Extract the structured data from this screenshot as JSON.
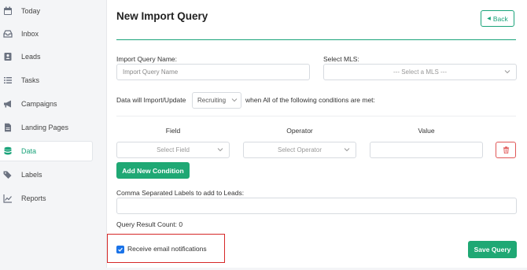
{
  "sidebar": {
    "items": [
      {
        "label": "Today",
        "icon": "calendar-icon"
      },
      {
        "label": "Inbox",
        "icon": "inbox-icon"
      },
      {
        "label": "Leads",
        "icon": "contact-card-icon"
      },
      {
        "label": "Tasks",
        "icon": "list-icon"
      },
      {
        "label": "Campaigns",
        "icon": "megaphone-icon"
      },
      {
        "label": "Landing Pages",
        "icon": "file-icon"
      },
      {
        "label": "Data",
        "icon": "database-icon",
        "active": true
      },
      {
        "label": "Labels",
        "icon": "tags-icon"
      },
      {
        "label": "Reports",
        "icon": "chart-line-icon"
      }
    ]
  },
  "header": {
    "title": "New Import Query",
    "back_label": "Back"
  },
  "form": {
    "query_name_label": "Import Query Name:",
    "query_name_placeholder": "Import Query Name",
    "mls_label": "Select MLS:",
    "mls_value": "--- Select a MLS ---",
    "import_prefix": "Data will Import/Update",
    "import_type_value": "Recruiting",
    "import_suffix": "when All of the following conditions are met:",
    "columns": {
      "field": "Field",
      "operator": "Operator",
      "value": "Value"
    },
    "field_value": "Select Field",
    "operator_value": "Select Operator",
    "add_condition_label": "Add New Condition",
    "labels_label": "Comma Separated Labels to add to Leads:",
    "result_count_label": "Query Result Count: 0",
    "email_notifications_label": "Receive email notifications",
    "email_notifications_checked": true,
    "save_label": "Save Query"
  },
  "colors": {
    "accent": "#1fa874",
    "danger": "#e05656",
    "highlight": "#d62828",
    "checkbox": "#1a73e8"
  }
}
